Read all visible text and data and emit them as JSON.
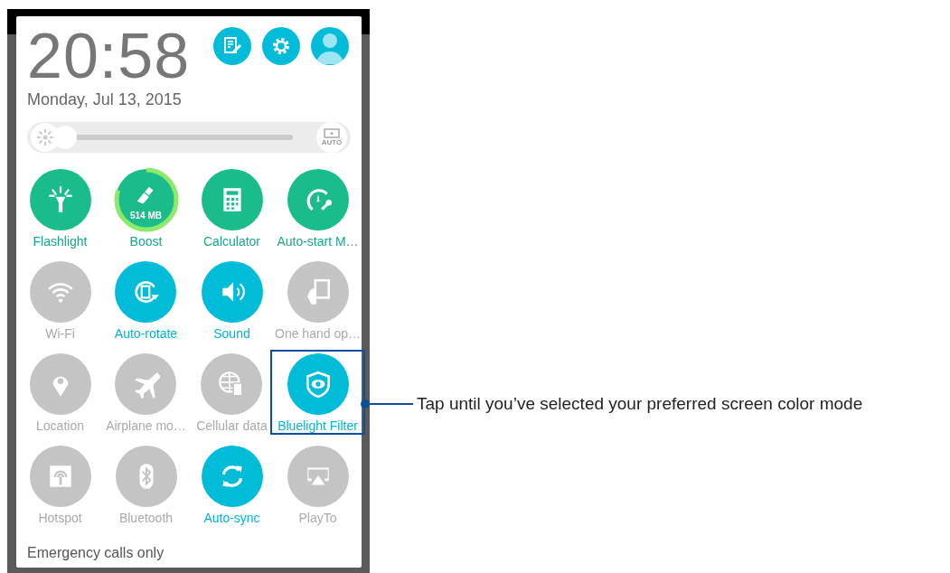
{
  "header": {
    "time": "20:58",
    "date": "Monday, Jul 13, 2015"
  },
  "brightness": {
    "level": 0.0,
    "auto_label": "AUTO"
  },
  "tiles": [
    {
      "label": "Flashlight",
      "kind": "shortcut",
      "on": true
    },
    {
      "label": "Boost",
      "kind": "meter",
      "on": true
    },
    {
      "label": "Calculator",
      "kind": "shortcut",
      "on": true
    },
    {
      "label": "Auto-start M…",
      "kind": "shortcut",
      "on": true
    },
    {
      "label": "Wi-Fi",
      "kind": "toggle",
      "on": false
    },
    {
      "label": "Auto-rotate",
      "kind": "toggle",
      "on": true
    },
    {
      "label": "Sound",
      "kind": "toggle",
      "on": true
    },
    {
      "label": "One hand op…",
      "kind": "toggle",
      "on": false
    },
    {
      "label": "Location",
      "kind": "toggle",
      "on": false
    },
    {
      "label": "Airplane mo…",
      "kind": "toggle",
      "on": false
    },
    {
      "label": "Cellular data",
      "kind": "toggle",
      "on": false
    },
    {
      "label": "Bluelight Filter",
      "kind": "toggle",
      "on": true,
      "highlighted": true
    },
    {
      "label": "Hotspot",
      "kind": "toggle",
      "on": false
    },
    {
      "label": "Bluetooth",
      "kind": "toggle",
      "on": false
    },
    {
      "label": "Auto-sync",
      "kind": "toggle",
      "on": true
    },
    {
      "label": "PlayTo",
      "kind": "toggle",
      "on": false
    }
  ],
  "boost_meter": {
    "reading": "514 MB",
    "level": 0.8
  },
  "status": "Emergency calls only",
  "callout": "Tap until you’ve selected your preferred screen color mode"
}
